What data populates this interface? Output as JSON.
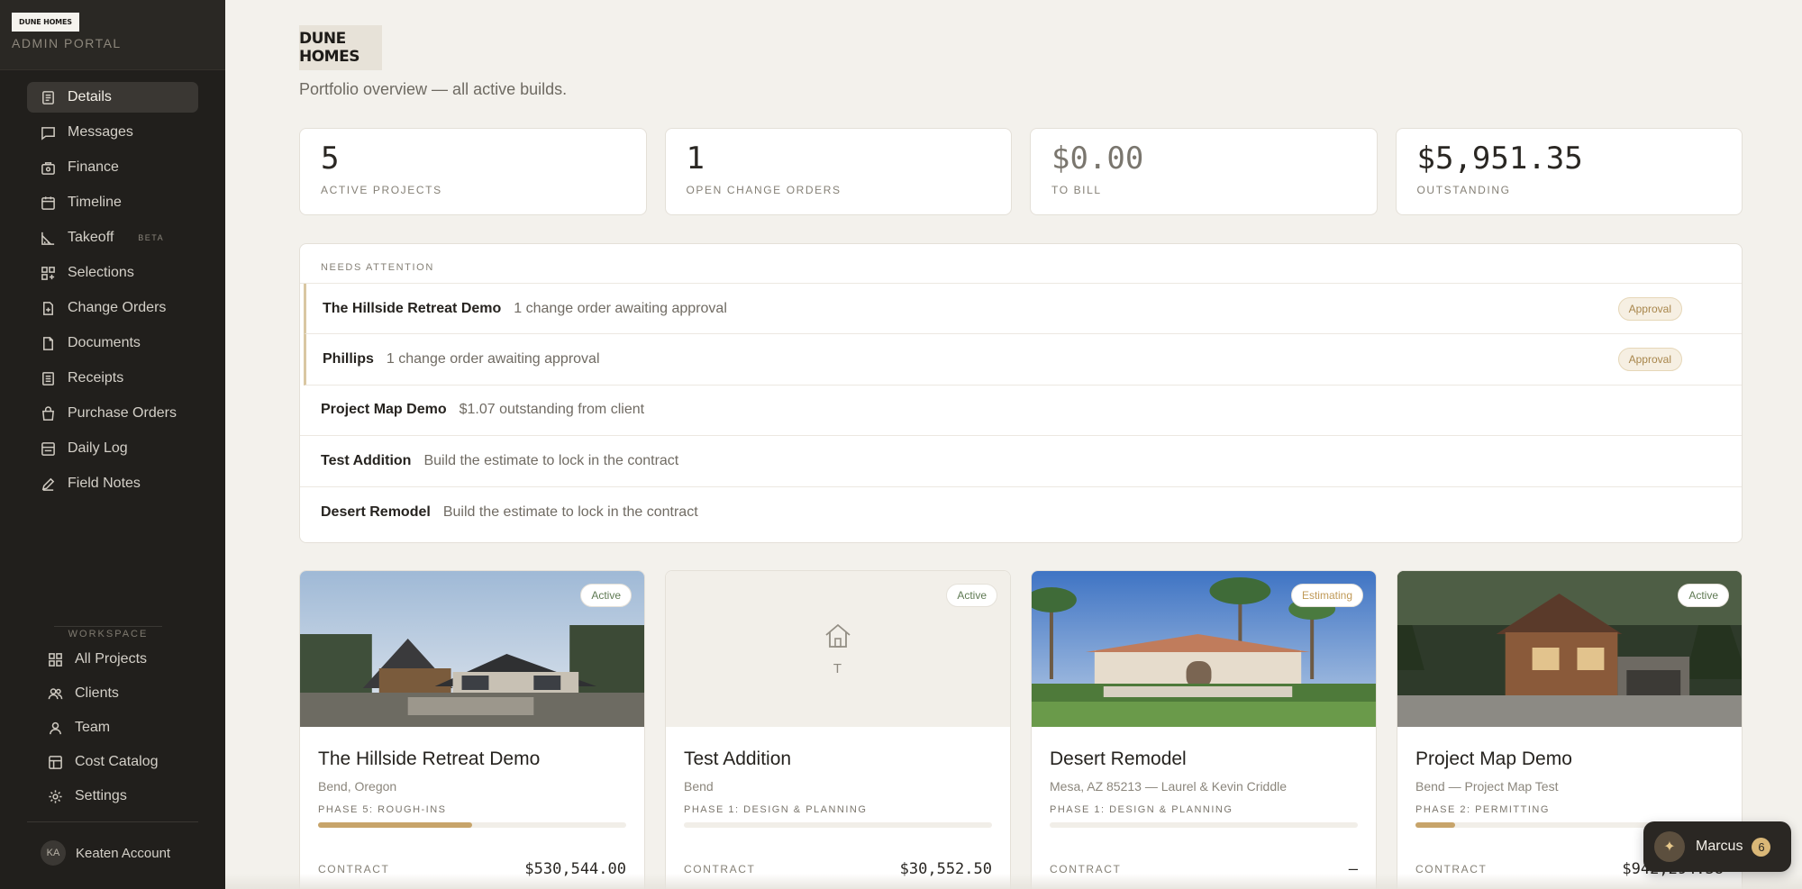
{
  "sidebar": {
    "brand_logo": "DUNE HOMES",
    "brand_sub": "ADMIN PORTAL",
    "items": [
      {
        "label": "Details",
        "icon": "document-icon"
      },
      {
        "label": "Messages",
        "icon": "message-icon"
      },
      {
        "label": "Finance",
        "icon": "finance-icon"
      },
      {
        "label": "Timeline",
        "icon": "calendar-icon"
      },
      {
        "label": "Takeoff",
        "icon": "ruler-icon",
        "badge": "BETA"
      },
      {
        "label": "Selections",
        "icon": "grid-plus-icon"
      },
      {
        "label": "Change Orders",
        "icon": "file-plus-icon"
      },
      {
        "label": "Documents",
        "icon": "file-icon"
      },
      {
        "label": "Receipts",
        "icon": "receipt-icon"
      },
      {
        "label": "Purchase Orders",
        "icon": "bag-icon"
      },
      {
        "label": "Daily Log",
        "icon": "log-icon"
      },
      {
        "label": "Field Notes",
        "icon": "pencil-icon"
      }
    ],
    "workspace_label": "WORKSPACE",
    "workspace_items": [
      {
        "label": "All Projects",
        "icon": "grid-icon"
      },
      {
        "label": "Clients",
        "icon": "users-icon"
      },
      {
        "label": "Team",
        "icon": "user-icon"
      },
      {
        "label": "Cost Catalog",
        "icon": "catalog-icon"
      },
      {
        "label": "Settings",
        "icon": "gear-icon"
      }
    ],
    "account": {
      "initials": "KA",
      "name": "Keaten Account"
    }
  },
  "header": {
    "logo_text": "DUNE HOMES",
    "subtitle": "Portfolio overview — all active builds."
  },
  "stats": [
    {
      "value": "5",
      "label": "ACTIVE PROJECTS"
    },
    {
      "value": "1",
      "label": "OPEN CHANGE ORDERS"
    },
    {
      "value": "$0.00",
      "label": "TO BILL"
    },
    {
      "value": "$5,951.35",
      "label": "OUTSTANDING"
    }
  ],
  "attention": {
    "title": "NEEDS ATTENTION",
    "items": [
      {
        "project": "The Hillside Retreat Demo",
        "text": "1 change order awaiting approval",
        "badge": "Approval"
      },
      {
        "project": "Phillips",
        "text": "1 change order awaiting approval",
        "badge": "Approval"
      },
      {
        "project": "Project Map Demo",
        "text": "$1.07 outstanding from client"
      },
      {
        "project": "Test Addition",
        "text": "Build the estimate to lock in the contract"
      },
      {
        "project": "Desert Remodel",
        "text": "Build the estimate to lock in the contract"
      }
    ]
  },
  "projects": [
    {
      "name": "The Hillside Retreat Demo",
      "location": "Bend, Oregon",
      "phase": "PHASE 5: ROUGH-INS",
      "progress": 0.5,
      "status": "Active",
      "contract_label": "CONTRACT",
      "contract": "$530,544.00"
    },
    {
      "name": "Test Addition",
      "location": "Bend",
      "phase": "PHASE 1: DESIGN & PLANNING",
      "progress": 0,
      "status": "Active",
      "placeholder_letter": "T",
      "contract_label": "CONTRACT",
      "contract": "$30,552.50"
    },
    {
      "name": "Desert Remodel",
      "location": "Mesa, AZ 85213 — Laurel & Kevin Criddle",
      "phase": "PHASE 1: DESIGN & PLANNING",
      "progress": 0,
      "status": "Estimating",
      "contract_label": "CONTRACT",
      "contract": "—"
    },
    {
      "name": "Project Map Demo",
      "location": "Bend — Project Map Test",
      "phase": "PHASE 2: PERMITTING",
      "progress": 0.13,
      "status": "Active",
      "contract_label": "CONTRACT",
      "contract": "$942,294.38"
    }
  ],
  "chat": {
    "name": "Marcus",
    "count": "6"
  },
  "colors": {
    "sidebar_bg": "#211f1c",
    "accent": "#c7a46a",
    "page_bg": "#f3f1ec",
    "status_active": "#5f7a53",
    "status_estimating": "#c09a58"
  }
}
